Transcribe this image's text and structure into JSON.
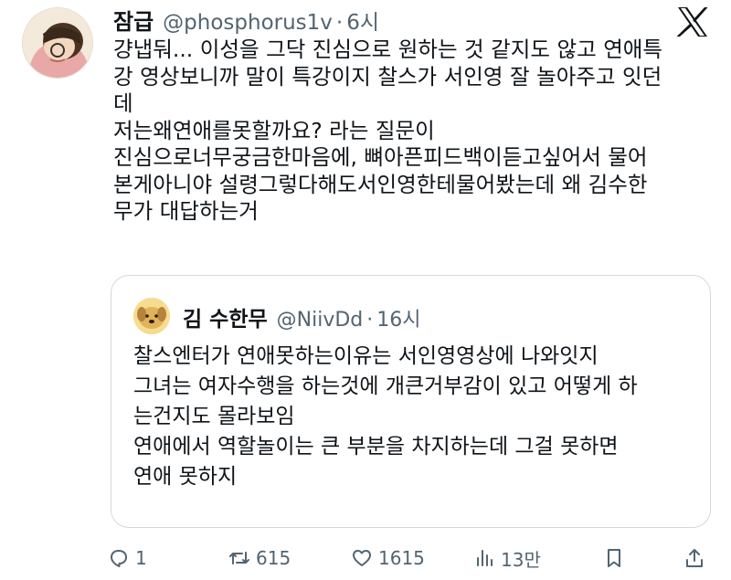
{
  "tweet": {
    "display_name": "잠급",
    "handle": "@phosphorus1v",
    "separator": "·",
    "time": "6시",
    "lines": [
      "걍냅둬... 이성을 그닥 진심으로 원하는 것 같지도 않고 연애특",
      "강 영상보니까 말이 특강이지 찰스가 서인영 잘 놀아주고 잇던",
      "데",
      "저는왜연애를못할까요? 라는 질문이",
      "진심으로너무궁금한마음에, 뼈아픈피드백이듣고싶어서 물어",
      "본게아니야 설령그렇다해도서인영한테물어봤는데 왜 김수한",
      "무가 대답하는거"
    ]
  },
  "quote": {
    "display_name": "김 수한무",
    "handle": "@NiivDd",
    "separator": "·",
    "time": "16시",
    "lines": [
      "찰스엔터가 연애못하는이유는 서인영영상에 나와잇지",
      "그녀는 여자수행을 하는것에 개큰거부감이 있고 어떻게 하",
      "는건지도 몰라보임",
      "연애에서 역할놀이는 큰 부분을 차지하는데 그걸 못하면",
      "연애 못하지"
    ]
  },
  "actions": {
    "replies": "1",
    "reposts": "615",
    "likes": "1615",
    "views": "13만"
  },
  "icons": {
    "platform": "x-logo-icon",
    "reply": "reply-icon",
    "repost": "repost-icon",
    "like": "heart-icon",
    "views": "views-icon",
    "bookmark": "bookmark-icon",
    "share": "share-icon"
  },
  "colors": {
    "text": "#0f1419",
    "secondary": "#536471",
    "border": "#cfd9de"
  }
}
